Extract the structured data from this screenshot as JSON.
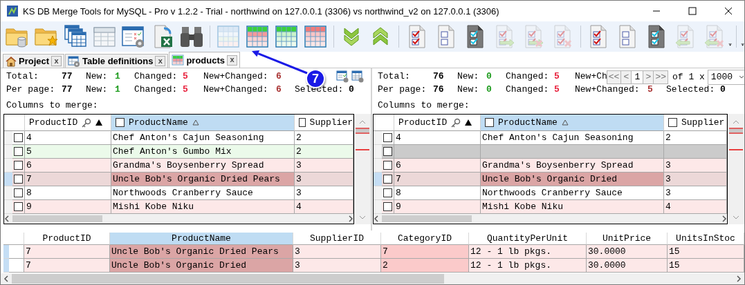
{
  "window": {
    "title": "KS DB Merge Tools for MySQL - Pro v 1.2.2 - Trial - northwind on 127.0.0.1 (3306) vs northwind_v2 on 127.0.0.1 (3306)"
  },
  "toolbar": {
    "groups": [
      {
        "items": [
          {
            "kind": "folder-db",
            "disabled": false
          },
          {
            "kind": "folder-star",
            "disabled": false
          },
          {
            "kind": "tables",
            "disabled": false
          },
          {
            "kind": "select-table",
            "disabled": false
          },
          {
            "kind": "settings-table",
            "disabled": false
          },
          {
            "kind": "excel-export",
            "disabled": false
          },
          {
            "kind": "binoculars",
            "disabled": false
          }
        ]
      },
      {
        "items": [
          {
            "kind": "grid-plain",
            "disabled": false
          },
          {
            "kind": "grid-mixed",
            "disabled": false
          },
          {
            "kind": "grid-new",
            "disabled": false
          },
          {
            "kind": "grid-changed",
            "disabled": false
          }
        ]
      },
      {
        "items": [
          {
            "kind": "arrows-down",
            "disabled": false
          },
          {
            "kind": "arrows-up",
            "disabled": false
          }
        ]
      },
      {
        "items": [
          {
            "kind": "doc-checked",
            "disabled": false
          },
          {
            "kind": "doc-unchecked",
            "disabled": false
          },
          {
            "kind": "doc-dark",
            "disabled": false
          },
          {
            "kind": "doc-copy-right",
            "disabled": true
          },
          {
            "kind": "doc-copy-delete-right",
            "disabled": true
          },
          {
            "kind": "doc-delete",
            "disabled": true
          }
        ]
      },
      {
        "items": [
          {
            "kind": "doc-checked",
            "disabled": false
          },
          {
            "kind": "doc-unchecked",
            "disabled": false
          },
          {
            "kind": "doc-dark",
            "disabled": false
          },
          {
            "kind": "doc-copy-left",
            "disabled": true
          },
          {
            "kind": "doc-copy-delete-left",
            "disabled": true
          }
        ]
      }
    ]
  },
  "tabs": [
    {
      "label": "Project",
      "kind": "home",
      "close": "x",
      "selected": false
    },
    {
      "label": "Table definitions",
      "kind": "table-settings",
      "close": "x",
      "selected": false
    },
    {
      "label": "products",
      "kind": "grid",
      "close": "x",
      "selected": true
    }
  ],
  "callout": {
    "label": "7"
  },
  "panels": [
    {
      "stats": [
        [
          {
            "label": "Total:",
            "value": "77",
            "color": "#000000"
          },
          {
            "label": "New:",
            "value": "1",
            "color": "#1a9a1a"
          },
          {
            "label": "Changed:",
            "value": "5",
            "color": "#e8203c"
          },
          {
            "label": "New+Changed:",
            "value": "6",
            "color": "#a83232"
          }
        ],
        [
          {
            "label": "Per page:",
            "value": "77",
            "color": "#000000"
          },
          {
            "label": "New:",
            "value": "1",
            "color": "#1a9a1a"
          },
          {
            "label": "Changed:",
            "value": "5",
            "color": "#e8203c"
          },
          {
            "label": "New+Changed:",
            "value": "6",
            "color": "#a83232"
          },
          {
            "label": "Selected:",
            "value": "0",
            "color": "#000000"
          }
        ]
      ],
      "columns_label": "Columns to merge:",
      "grid": {
        "columns": [
          {
            "label": "ProductID",
            "kind": "key-sorted",
            "highlighted": false
          },
          {
            "label": "ProductName",
            "kind": "sorted",
            "checked": false,
            "highlighted": true
          },
          {
            "label": "Supplier",
            "kind": "plain",
            "checked": false,
            "highlighted": false
          }
        ],
        "rows": [
          {
            "kind": "same",
            "current": false,
            "checked": false,
            "cells": [
              {
                "text": "4"
              },
              {
                "text": "Chef Anton's Cajun Seasoning"
              },
              {
                "text": "2"
              }
            ]
          },
          {
            "kind": "new",
            "current": false,
            "checked": false,
            "cells": [
              {
                "text": "5"
              },
              {
                "text": "Chef Anton's Gumbo Mix"
              },
              {
                "text": "2"
              }
            ]
          },
          {
            "kind": "changed",
            "current": false,
            "checked": false,
            "cells": [
              {
                "text": "6"
              },
              {
                "text": "Grandma's Boysenberry Spread"
              },
              {
                "text": "3"
              }
            ]
          },
          {
            "kind": "changed",
            "current": true,
            "checked": false,
            "cells": [
              {
                "text": "7"
              },
              {
                "text": "Uncle Bob's Organic Dried Pears",
                "kind": "strong"
              },
              {
                "text": "3"
              }
            ]
          },
          {
            "kind": "same",
            "current": false,
            "checked": false,
            "cells": [
              {
                "text": "8"
              },
              {
                "text": "Northwoods Cranberry Sauce"
              },
              {
                "text": "3"
              }
            ]
          },
          {
            "kind": "changed",
            "current": false,
            "checked": false,
            "cells": [
              {
                "text": "9"
              },
              {
                "text": "Mishi Kobe Niku"
              },
              {
                "text": "4"
              }
            ]
          }
        ]
      }
    },
    {
      "stats": [
        [
          {
            "label": "Total:",
            "value": "76",
            "color": "#000000"
          },
          {
            "label": "New:",
            "value": "0",
            "color": "#1a9a1a"
          },
          {
            "label": "Changed:",
            "value": "5",
            "color": "#e8203c"
          },
          {
            "label": "New+Ch"
          }
        ],
        [
          {
            "label": "Per page:",
            "value": "76",
            "color": "#000000"
          },
          {
            "label": "New:",
            "value": "0",
            "color": "#1a9a1a"
          },
          {
            "label": "Changed:",
            "value": "5",
            "color": "#e8203c"
          },
          {
            "label": "New+Changed:",
            "value": "5",
            "color": "#a83232"
          },
          {
            "label": "Selected:",
            "value": "0",
            "color": "#000000"
          }
        ]
      ],
      "pager": {
        "first": "<<",
        "prev": "<",
        "page": "1",
        "next": ">",
        "last": ">>",
        "of": "of 1 x",
        "page_size": "1000"
      },
      "columns_label": "Columns to merge:",
      "grid": {
        "columns": [
          {
            "label": "ProductID",
            "kind": "key-sorted",
            "highlighted": false
          },
          {
            "label": "ProductName",
            "kind": "sorted",
            "checked": false,
            "highlighted": true
          },
          {
            "label": "Supplier",
            "kind": "plain",
            "checked": false,
            "highlighted": false
          }
        ],
        "rows": [
          {
            "kind": "same",
            "current": false,
            "checked": false,
            "cells": [
              {
                "text": "4"
              },
              {
                "text": "Chef Anton's Cajun Seasoning"
              },
              {
                "text": "2"
              }
            ]
          },
          {
            "kind": "missing",
            "current": false,
            "checked": false
          },
          {
            "kind": "changed",
            "current": false,
            "checked": false,
            "cells": [
              {
                "text": "6"
              },
              {
                "text": "Grandma's Boysenberry Spread"
              },
              {
                "text": "3"
              }
            ]
          },
          {
            "kind": "changed",
            "current": true,
            "checked": false,
            "cells": [
              {
                "text": "7"
              },
              {
                "text": "Uncle Bob's Organic Dried",
                "kind": "strong"
              },
              {
                "text": "3"
              }
            ]
          },
          {
            "kind": "same",
            "current": false,
            "checked": false,
            "cells": [
              {
                "text": "8"
              },
              {
                "text": "Northwoods Cranberry Sauce"
              },
              {
                "text": "3"
              }
            ]
          },
          {
            "kind": "changed",
            "current": false,
            "checked": false,
            "cells": [
              {
                "text": "9"
              },
              {
                "text": "Mishi Kobe Niku"
              },
              {
                "text": "4"
              }
            ]
          }
        ]
      }
    }
  ],
  "details": {
    "columns": [
      {
        "label": "ProductID",
        "highlighted": false
      },
      {
        "label": "ProductName",
        "highlighted": true
      },
      {
        "label": "SupplierID",
        "highlighted": false
      },
      {
        "label": "CategoryID",
        "highlighted": false
      },
      {
        "label": "QuantityPerUnit",
        "highlighted": false
      },
      {
        "label": "UnitPrice",
        "highlighted": false
      },
      {
        "label": "UnitsInStoc",
        "highlighted": false
      }
    ],
    "rows": [
      {
        "kind": "changed",
        "current": true,
        "cells": [
          {
            "text": "7"
          },
          {
            "text": "Uncle Bob's Organic Dried Pears",
            "kind": "strong"
          },
          {
            "text": "3"
          },
          {
            "text": "7",
            "kind": "soft"
          },
          {
            "text": "12 - 1 lb pkgs."
          },
          {
            "text": "30.0000"
          },
          {
            "text": "15"
          }
        ]
      },
      {
        "kind": "changed",
        "current": true,
        "cells": [
          {
            "text": "7"
          },
          {
            "text": "Uncle Bob's Organic Dried",
            "kind": "strong"
          },
          {
            "text": "3"
          },
          {
            "text": "2",
            "kind": "soft"
          },
          {
            "text": "12 - 1 lb pkgs."
          },
          {
            "text": "30.0000"
          },
          {
            "text": "15"
          }
        ]
      }
    ]
  }
}
